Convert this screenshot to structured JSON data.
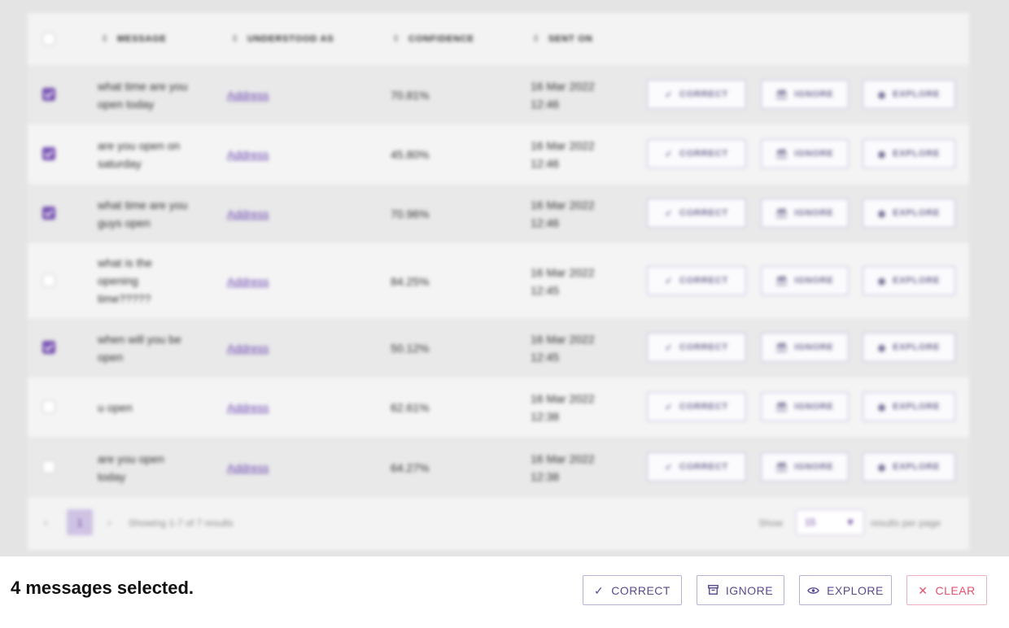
{
  "table": {
    "headers": {
      "message": "MESSAGE",
      "understood_as": "UNDERSTOOD AS",
      "confidence": "CONFIDENCE",
      "sent_on": "SENT ON"
    },
    "rows": [
      {
        "selected": true,
        "message": "what time are you open today",
        "intent": "Address",
        "confidence": "70.81%",
        "sent_on": "16 Mar 2022 12:46"
      },
      {
        "selected": true,
        "message": "are you open on saturday",
        "intent": "Address",
        "confidence": "45.80%",
        "sent_on": "16 Mar 2022 12:46"
      },
      {
        "selected": true,
        "message": "what time are you guys open",
        "intent": "Address",
        "confidence": "70.96%",
        "sent_on": "16 Mar 2022 12:46"
      },
      {
        "selected": false,
        "message": "what is the opening time?????",
        "intent": "Address",
        "confidence": "84.25%",
        "sent_on": "16 Mar 2022 12:45"
      },
      {
        "selected": true,
        "message": "when will you be open",
        "intent": "Address",
        "confidence": "50.12%",
        "sent_on": "16 Mar 2022 12:45"
      },
      {
        "selected": false,
        "message": "u open",
        "intent": "Address",
        "confidence": "62.61%",
        "sent_on": "16 Mar 2022 12:38"
      },
      {
        "selected": false,
        "message": "are you open today",
        "intent": "Address",
        "confidence": "64.27%",
        "sent_on": "16 Mar 2022 12:38"
      }
    ],
    "row_actions": {
      "correct": "CORRECT",
      "ignore": "IGNORE",
      "explore": "EXPLORE"
    }
  },
  "pagination": {
    "current_page": "1",
    "summary": "Showing 1-7 of 7 results",
    "show_label": "Show",
    "per_page_value": "15",
    "per_page_suffix": "results per page"
  },
  "selection_bar": {
    "text": "4 messages selected.",
    "correct_label": "CORRECT",
    "ignore_label": "IGNORE",
    "explore_label": "EXPLORE",
    "clear_label": "CLEAR"
  },
  "colors": {
    "accent": "#7a56b6",
    "clear": "#e2526e",
    "background": "#e4e4e4"
  },
  "icons": {
    "correct": "check-icon",
    "ignore": "archive-icon",
    "explore": "eye-icon",
    "clear": "close-icon",
    "sort": "sort-icon",
    "select": "chevron-down-icon"
  }
}
